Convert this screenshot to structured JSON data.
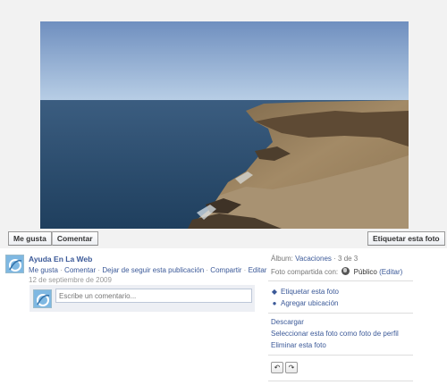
{
  "photo_buttons": {
    "like": "Me gusta",
    "comment": "Comentar",
    "tag": "Etiquetar esta foto"
  },
  "post": {
    "author": "Ayuda En La Web",
    "actions": [
      "Me gusta",
      "Comentar",
      "Dejar de seguir esta publicación",
      "Compartir",
      "Editar"
    ],
    "separator": "·",
    "date": "12 de septiembre de 2009",
    "comment_placeholder": "Escribe un comentario..."
  },
  "sidebar": {
    "album_label": "Álbum:",
    "album_name": "Vacaciones",
    "album_sep": " · ",
    "album_count": "3 de 3",
    "shared_label": "Foto compartida con:",
    "privacy": "Público",
    "privacy_edit": "(Editar)",
    "tag_photo": "Etiquetar esta foto",
    "add_location": "Agregar ubicación",
    "download": "Descargar",
    "set_profile": "Seleccionar esta foto como foto de perfil",
    "delete": "Eliminar esta foto",
    "rotate_left": "↶",
    "rotate_right": "↷"
  },
  "icons": {
    "globe": "globe-icon",
    "tag": "tag-icon",
    "pin": "location-pin-icon"
  }
}
